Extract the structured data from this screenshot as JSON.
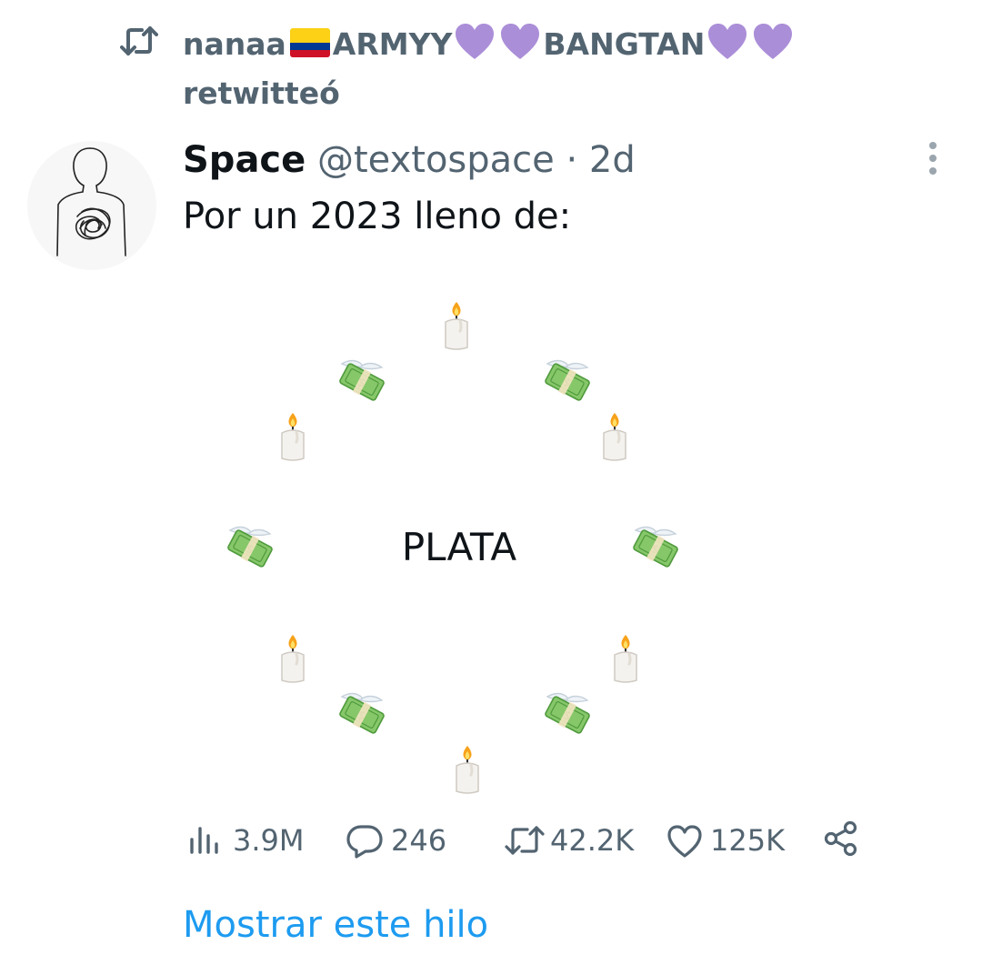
{
  "retweet_banner": {
    "user_name_start": "nanaa",
    "user_name_mid": "ARMYY",
    "user_name_end": "BANGTAN",
    "action": "retwitteó",
    "colors": {
      "flag_yellow": "#fcd116",
      "flag_blue": "#003893",
      "flag_red": "#ce1126",
      "heart": "#ab8ed8"
    }
  },
  "tweet": {
    "author_name": "Space",
    "handle": "@textospace",
    "separator": "·",
    "time": "2d",
    "text": "Por un 2023 lleno de:",
    "center_word": "PLATA",
    "art_icons": [
      "candle-icon",
      "money-with-wings-icon"
    ]
  },
  "actions": {
    "views": "3.9M",
    "replies": "246",
    "retweets": "42.2K",
    "likes": "125K"
  },
  "icons": {
    "retweet": "retweet-icon",
    "more": "more-vertical-icon",
    "views": "bar-chart-icon",
    "reply": "speech-bubble-icon",
    "like": "heart-outline-icon",
    "share": "share-icon"
  },
  "colors": {
    "text_primary": "#0f1419",
    "text_secondary": "#536471",
    "link": "#1d9bf0"
  },
  "show_thread": "Mostrar este hilo"
}
